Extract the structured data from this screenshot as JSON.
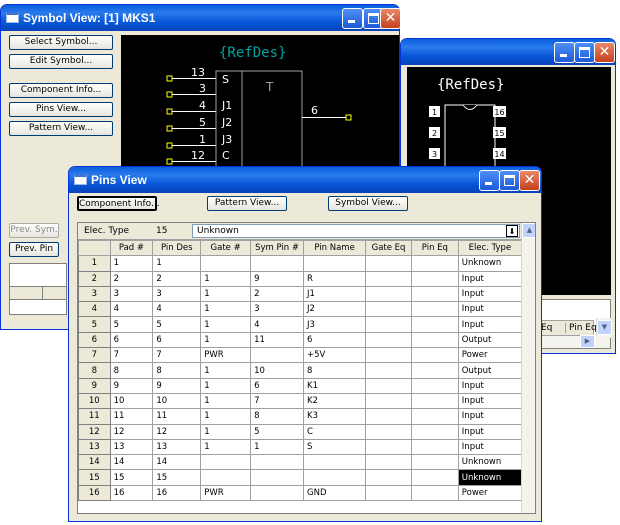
{
  "symbol_window": {
    "title": "Symbol View: [1] MKS1",
    "buttons": {
      "select_symbol": "Select Symbol...",
      "edit_symbol": "Edit Symbol...",
      "component_info": "Component Info...",
      "pins_view": "Pins View...",
      "pattern_view": "Pattern View...",
      "prev_sym": "Prev. Sym.",
      "prev_pin": "Prev. Pin"
    },
    "refdes": "{RefDes}",
    "box_label": "T",
    "left_pins": [
      {
        "num": "13",
        "name": "S"
      },
      {
        "num": "3",
        "name": ""
      },
      {
        "num": "4",
        "name": "J1"
      },
      {
        "num": "5",
        "name": "J2"
      },
      {
        "num": "1",
        "name": "J3"
      },
      {
        "num": "12",
        "name": "C"
      },
      {
        "num": "9",
        "name": "K1"
      }
    ],
    "right_pin": {
      "num": "6"
    }
  },
  "pattern_window": {
    "refdes": "{RefDes}",
    "left_pads": [
      "1",
      "2",
      "3"
    ],
    "right_pads": [
      "16",
      "15",
      "14"
    ],
    "columns": [
      "Eq",
      "Pin Eq"
    ]
  },
  "pins_window": {
    "title": "Pins View",
    "buttons": {
      "component_info": "Component Info...",
      "pattern_view": "Pattern View...",
      "symbol_view": "Symbol View..."
    },
    "elec_type_label": "Elec. Type",
    "elec_type_count": "15",
    "elec_type_value": "Unknown",
    "columns": [
      "Pad #",
      "Pin Des",
      "Gate #",
      "Sym Pin #",
      "Pin Name",
      "Gate Eq",
      "Pin Eq",
      "Elec. Type"
    ],
    "rows": [
      [
        "1",
        "1",
        "1",
        "",
        "",
        "",
        "",
        "",
        "Unknown"
      ],
      [
        "2",
        "2",
        "2",
        "1",
        "9",
        "R",
        "",
        "",
        "Input"
      ],
      [
        "3",
        "3",
        "3",
        "1",
        "2",
        "J1",
        "",
        "",
        "Input"
      ],
      [
        "4",
        "4",
        "4",
        "1",
        "3",
        "J2",
        "",
        "",
        "Input"
      ],
      [
        "5",
        "5",
        "5",
        "1",
        "4",
        "J3",
        "",
        "",
        "Input"
      ],
      [
        "6",
        "6",
        "6",
        "1",
        "11",
        "6",
        "",
        "",
        "Output"
      ],
      [
        "7",
        "7",
        "7",
        "PWR",
        "",
        "+5V",
        "",
        "",
        "Power"
      ],
      [
        "8",
        "8",
        "8",
        "1",
        "10",
        "8",
        "",
        "",
        "Output"
      ],
      [
        "9",
        "9",
        "9",
        "1",
        "6",
        "K1",
        "",
        "",
        "Input"
      ],
      [
        "10",
        "10",
        "10",
        "1",
        "7",
        "K2",
        "",
        "",
        "Input"
      ],
      [
        "11",
        "11",
        "11",
        "1",
        "8",
        "K3",
        "",
        "",
        "Input"
      ],
      [
        "12",
        "12",
        "12",
        "1",
        "5",
        "C",
        "",
        "",
        "Input"
      ],
      [
        "13",
        "13",
        "13",
        "1",
        "1",
        "S",
        "",
        "",
        "Input"
      ],
      [
        "14",
        "14",
        "14",
        "",
        "",
        "",
        "",
        "",
        "Unknown"
      ],
      [
        "15",
        "15",
        "15",
        "",
        "",
        "",
        "",
        "",
        "Unknown"
      ],
      [
        "16",
        "16",
        "16",
        "PWR",
        "",
        "GND",
        "",
        "",
        "Power"
      ]
    ],
    "selected_row": 14
  },
  "colors": {
    "canvas_bg": "#000000",
    "refdes": "#00a3a3",
    "pin_wire": "#ffffff",
    "pin_end": "#ffff00",
    "body": "#a0a0a0"
  }
}
